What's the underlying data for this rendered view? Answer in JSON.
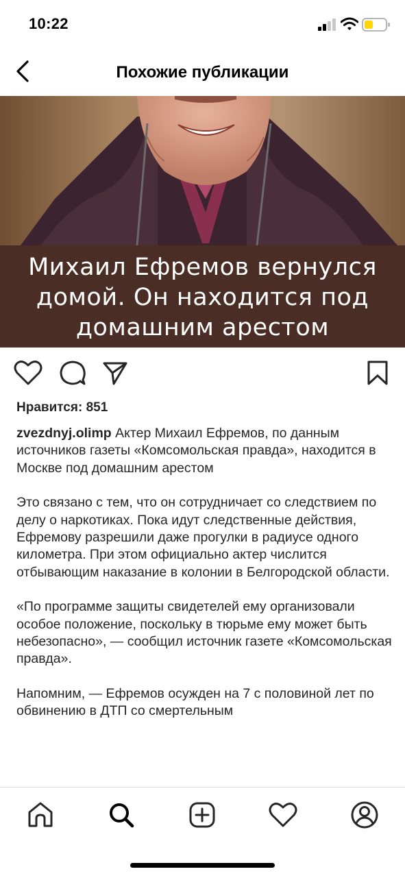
{
  "status_bar": {
    "time": "10:22"
  },
  "header": {
    "title": "Похожие публикации"
  },
  "post": {
    "image_caption": [
      "Михаил Ефремов вернулся",
      "домой. Он находится под",
      "домашним арестом"
    ],
    "likes": "Нравится: 851",
    "username": "zvezdnyj.olimp",
    "caption_first": "Актер Михаил Ефремов, по данным источников газеты «Комсомольская правда», находится в Москве под домашним арестом",
    "paragraphs": [
      "Это связано с тем, что он сотрудничает со следствием по делу о наркотиках. Пока идут следственные действия, Ефремову разрешили даже прогулки в радиусе одного километра. При этом официально актер числится отбывающим наказание в колонии в Белгородской области.",
      "«По программе защиты свидетелей ему организовали особое положение, поскольку в тюрьме ему может быть небезопасно», — сообщил источник газете «Комсомольская правда».",
      "Напомним, — Ефремов осужден на 7 с половиной лет по обвинению в ДТП со смертельным"
    ]
  },
  "icons": {
    "back": "chevron-left-icon",
    "like": "heart-icon",
    "comment": "comment-icon",
    "share": "send-icon",
    "save": "bookmark-icon",
    "tabs": [
      "home-icon",
      "search-icon",
      "add-post-icon",
      "activity-heart-icon",
      "profile-icon"
    ]
  },
  "colors": {
    "caption_band": "#4a2e25",
    "battery": "#ffd60a"
  }
}
